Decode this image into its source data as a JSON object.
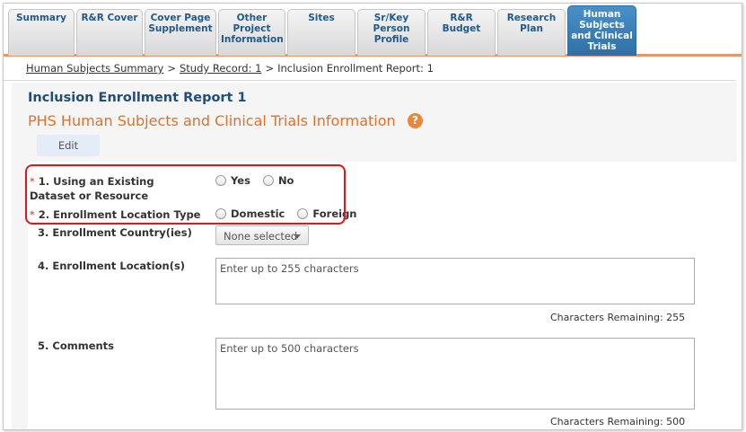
{
  "tabs": [
    {
      "label": "Summary",
      "active": false
    },
    {
      "label": "R&R Cover",
      "active": false
    },
    {
      "label": "Cover Page Supplement",
      "active": false
    },
    {
      "label": "Other Project Information",
      "active": false
    },
    {
      "label": "Sites",
      "active": false
    },
    {
      "label": "Sr/Key Person Profile",
      "active": false
    },
    {
      "label": "R&R Budget",
      "active": false
    },
    {
      "label": "Research Plan",
      "active": false
    },
    {
      "label": "Human Subjects and Clinical Trials",
      "active": true
    }
  ],
  "breadcrumb": {
    "items": [
      "Human Subjects Summary",
      "Study Record: 1"
    ],
    "current": "Inclusion Enrollment Report: 1",
    "separator": ">"
  },
  "page": {
    "report_title": "Inclusion Enrollment Report 1",
    "section_title": "PHS Human Subjects and Clinical Trials Information",
    "help_icon": "question-circle-icon",
    "edit_label": "Edit"
  },
  "form": {
    "q1": {
      "number": "1.",
      "label": "Using an Existing Dataset or Resource",
      "required": "*",
      "options": [
        "Yes",
        "No"
      ]
    },
    "q2": {
      "number": "2.",
      "label": "Enrollment Location Type",
      "required": "*",
      "options": [
        "Domestic",
        "Foreign"
      ]
    },
    "q3": {
      "number": "3.",
      "label": "Enrollment Country(ies)",
      "select_value": "None selected"
    },
    "q4": {
      "number": "4.",
      "label": "Enrollment Location(s)",
      "placeholder": "Enter up to 255 characters",
      "remaining": "Characters Remaining: 255"
    },
    "q5": {
      "number": "5.",
      "label": "Comments",
      "placeholder": "Enter up to 500 characters",
      "remaining": "Characters Remaining: 500"
    }
  },
  "colors": {
    "accent_orange": "#d9732e",
    "title_blue": "#1f4e79",
    "active_tab": "#2e6fa6",
    "highlight_red": "#e0161b"
  }
}
